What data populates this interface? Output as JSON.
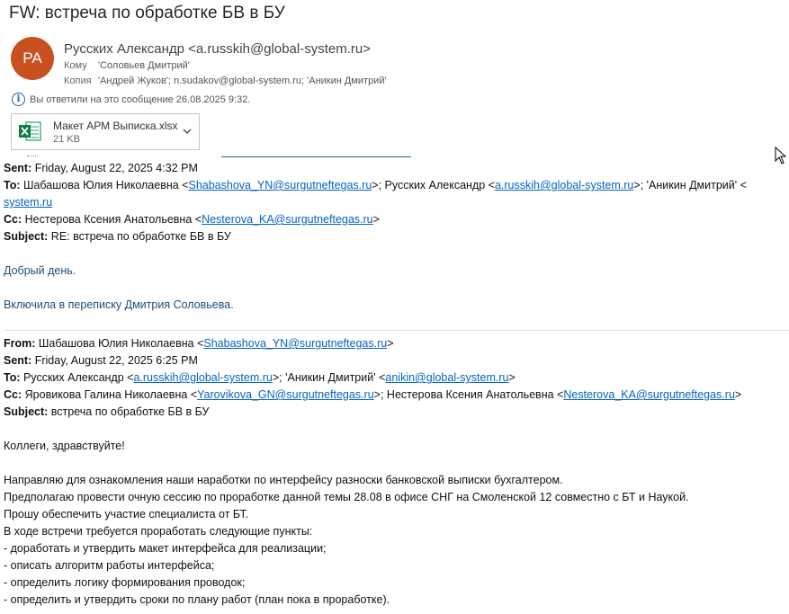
{
  "email": {
    "subject": "FW: встреча по обработке БВ в БУ",
    "avatar_initials": "РА",
    "sender": "Русских Александр <a.russkih@global-system.ru>",
    "to_label": "Кому",
    "to": "'Соловьев Дмитрий'",
    "cc_label": "Копия",
    "cc": "'Андрей Жуков'; n.sudakov@global-system.ru; 'Аникин Дмитрий'",
    "replied_info": "Вы ответили на это сообщение 26.08.2025 9:32.",
    "attachment": {
      "name": "Макет АРМ Выписка.xlsx",
      "size": "21 KB"
    }
  },
  "labels": {
    "from": "From:",
    "sent": "Sent:",
    "to": "To:",
    "cc": "Cc:",
    "subject": "Subject:"
  },
  "msg1": {
    "sent": "Friday, August 22, 2025 4:32 PM",
    "to_a": "Шабашова Юлия Николаевна <",
    "to_link1": "Shabashova_YN@surgutneftegas.ru",
    "to_b": ">; Русских Александр <",
    "to_link2": "a.russkih@global-system.ru",
    "to_c": ">; 'Аникин Дмитрий' <",
    "to_link3": "anikin@global-system.ru",
    "to_link3_visible": "system.ru",
    "to_d": ">",
    "cc_a": "Нестерова Ксения Анатольевна <",
    "cc_link": "Nesterova_KA@surgutneftegas.ru",
    "cc_b": ">",
    "subject": "RE: встреча по обработке БВ в БУ",
    "greeting": "Добрый день.",
    "text": "Включила в переписку Дмитрия Соловьева."
  },
  "msg2": {
    "from_a": "Шабашова Юлия Николаевна <",
    "from_link": "Shabashova_YN@surgutneftegas.ru",
    "from_b": ">",
    "sent": "Friday, August 22, 2025 6:25 PM",
    "to_a": "Русских Александр <",
    "to_link1": "a.russkih@global-system.ru",
    "to_b": ">; 'Аникин Дмитрий' <",
    "to_link2": "anikin@global-system.ru",
    "to_c": ">",
    "cc_a": "Яровикова Галина Николаевна <",
    "cc_link1": "Yarovikova_GN@surgutneftegas.ru",
    "cc_b": ">; Нестерова Ксения Анатольевна <",
    "cc_link2": "Nesterova_KA@surgutneftegas.ru",
    "cc_c": ">",
    "subject": "встреча по обработке БВ в БУ",
    "greeting": "Коллеги, здравствуйте!",
    "lines": [
      "Направляю для ознакомления наши наработки по интерфейсу разноски банковской выписки бухгалтером.",
      "Предполагаю провести очную сессию по проработке данной темы 28.08 в офисе СНГ на Смоленской 12 совместно с БТ и Наукой.",
      "Прошу обеспечить участие специалиста от БТ.",
      "В ходе встречи требуется проработать следующие пункты:",
      "- доработать и утвердить макет интерфейса для реализации;",
      "- описать алгоритм работы интерфейса;",
      "- определить логику формирования проводок;",
      "- определить и утвердить сроки по плану работ (план пока в проработке)."
    ]
  }
}
